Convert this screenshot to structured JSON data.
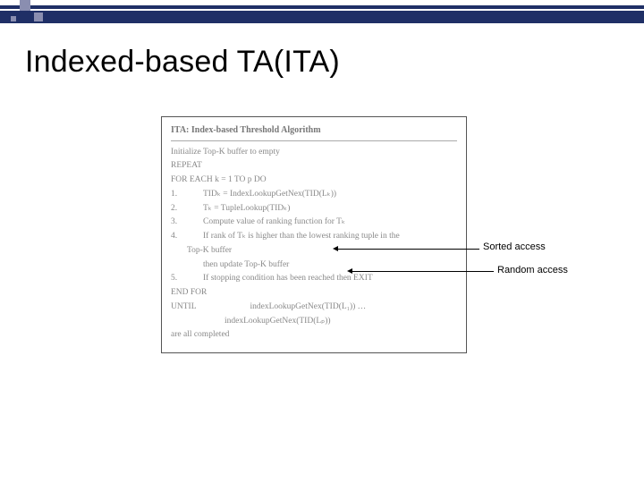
{
  "title": "Indexed-based TA(ITA)",
  "algo": {
    "header": "ITA: Index-based Threshold Algorithm",
    "init": "Initialize Top-K buffer to empty",
    "repeat": "REPEAT",
    "foreach": "FOR EACH k = 1 TO p DO",
    "s1n": "1.",
    "s1": "TIDₖ = IndexLookupGetNex(TID(Lₖ))",
    "s2n": "2.",
    "s2": "Tₖ = TupleLookup(TIDₖ)",
    "s3n": "3.",
    "s3": "Compute value of ranking function for Tₖ",
    "s4n": "4.",
    "s4": "If rank of Tₖ is higher than the lowest ranking tuple in the",
    "s4b": "Top-K buffer",
    "s4c": "then update Top-K buffer",
    "s5n": "5.",
    "s5": "If stopping condition has been reached then EXIT",
    "endfor": "END FOR",
    "until": "UNTIL",
    "u1": "indexLookupGetNex(TID(L₁)) …",
    "u2": "indexLookupGetNex(TID(Lₚ))",
    "done": "are all completed"
  },
  "labels": {
    "sorted": "Sorted access",
    "random": "Random access"
  }
}
